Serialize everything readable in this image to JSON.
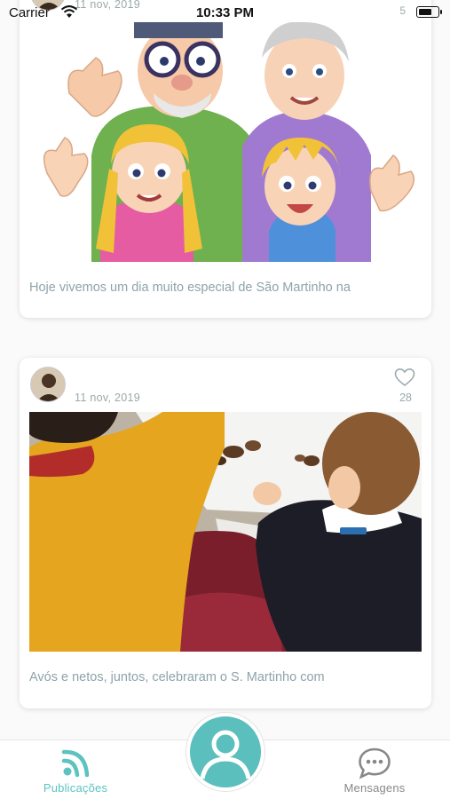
{
  "status_bar": {
    "carrier": "Carrier",
    "time": "10:33 PM",
    "badge": "5",
    "battery_level": 0.75
  },
  "posts": [
    {
      "date": "11 nov, 2019",
      "caption": "Hoje vivemos um dia muito especial de São Martinho na",
      "image_desc": "cartoon-grandparents-grandchildren"
    },
    {
      "date": "11 nov, 2019",
      "likes": "28",
      "caption": "Avós e netos, juntos, celebraram o S. Martinho com",
      "image_desc": "photo-chestnut-celebration"
    }
  ],
  "tab_bar": {
    "feed_label": "Publicações",
    "messages_label": "Mensagens",
    "active_color": "#5cc3c0",
    "inactive_color": "#888888",
    "fab_color": "#5bbfbd"
  }
}
